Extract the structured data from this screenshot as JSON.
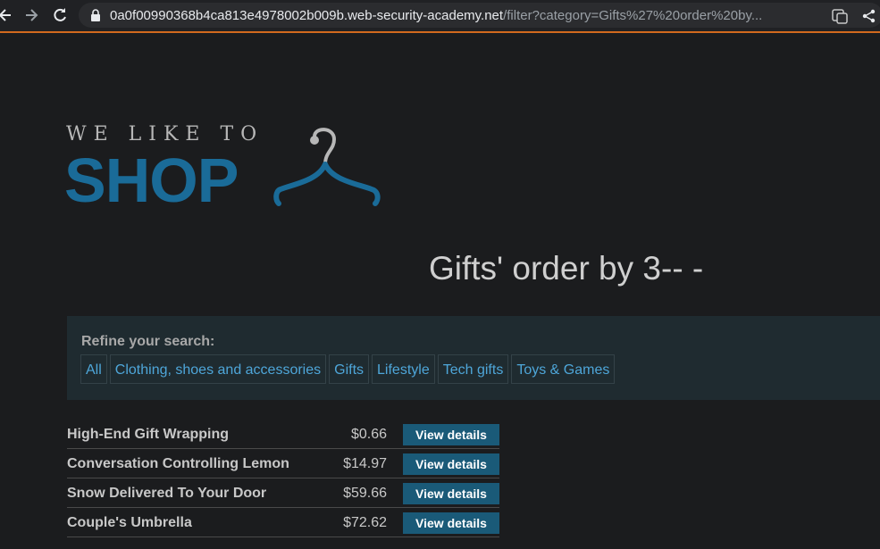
{
  "browser": {
    "url_host": "0a0f00990368b4ca813e4978002b009b.web-security-academy.net",
    "url_path": "/filter?category=Gifts%27%20order%20by...",
    "icons": [
      "back-icon",
      "forward-icon",
      "reload-icon",
      "lock-icon",
      "translate-icon",
      "share-icon"
    ]
  },
  "logo": {
    "small": "WE LIKE TO",
    "big": "SHOP"
  },
  "page": {
    "heading": "Gifts' order by 3-- -"
  },
  "filter": {
    "label": "Refine your search:",
    "categories": [
      "All",
      "Clothing, shoes and accessories",
      "Gifts",
      "Lifestyle",
      "Tech gifts",
      "Toys & Games"
    ]
  },
  "products": [
    {
      "name": "High-End Gift Wrapping",
      "price": "$0.66",
      "button": "View details"
    },
    {
      "name": "Conversation Controlling Lemon",
      "price": "$14.97",
      "button": "View details"
    },
    {
      "name": "Snow Delivered To Your Door",
      "price": "$59.66",
      "button": "View details"
    },
    {
      "name": "Couple's Umbrella",
      "price": "$72.62",
      "button": "View details"
    }
  ],
  "colors": {
    "background": "#1b1c1e",
    "brand_blue": "#1a6b98",
    "link": "#4ea6d9",
    "button": "#1a5a78",
    "panel": "#1f2b30"
  }
}
